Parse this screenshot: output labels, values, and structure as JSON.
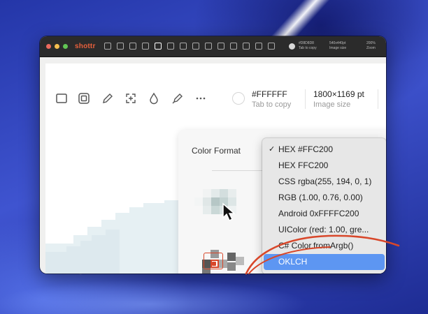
{
  "app": {
    "name": "shottr"
  },
  "titlebar_info": {
    "hex": "#D8D8D8",
    "hex_sub": "Tab to copy",
    "size": "540x440pt",
    "size_sub": "Image size",
    "zoom": "200%",
    "zoom_sub": "Zoom"
  },
  "toolbar": {
    "hex_value": "#FFFFFF",
    "hex_hint": "Tab to copy",
    "image_size": "1800×1169 pt",
    "image_size_label": "Image size",
    "tools": [
      "rectangle-icon",
      "screenshot-icon",
      "pencil-icon",
      "add-selection-icon",
      "drop-icon",
      "marker-icon",
      "more-icon"
    ]
  },
  "popover": {
    "label": "Color Format"
  },
  "menu": {
    "items": [
      {
        "label": "HEX #FFC200",
        "checked": true
      },
      {
        "label": "HEX FFC200"
      },
      {
        "label": "CSS rgba(255, 194, 0, 1)"
      },
      {
        "label": "RGB (1.00, 0.76, 0.00)"
      },
      {
        "label": "Android 0xFFFFC200"
      },
      {
        "label": "UIColor (red: 1.00, gre..."
      },
      {
        "label": "C# Color.fromArgb()"
      },
      {
        "label": "OKLCH",
        "selected": true
      }
    ]
  },
  "colors": {
    "accent": "#e8603c",
    "selection": "#5d96f2",
    "annotation": "#d8472a"
  }
}
